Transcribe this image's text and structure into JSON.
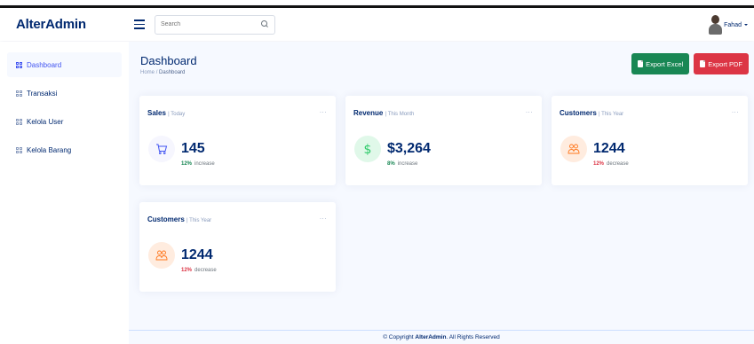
{
  "app": {
    "logo": "AlterAdmin"
  },
  "header": {
    "search_placeholder": "Search",
    "user_name": "Fahad"
  },
  "sidebar": {
    "items": [
      {
        "label": "Dashboard",
        "active": true
      },
      {
        "label": "Transaksi",
        "active": false
      },
      {
        "label": "Kelola User",
        "active": false
      },
      {
        "label": "Kelola Barang",
        "active": false
      }
    ]
  },
  "page": {
    "title": "Dashboard",
    "breadcrumb": {
      "home": "Home",
      "current": "Dashboard"
    },
    "export_excel": "Export Excel",
    "export_pdf": "Export PDF"
  },
  "cards": [
    {
      "title": "Sales",
      "period": "| Today",
      "value": "145",
      "change": "12%",
      "change_word": "increase",
      "icon": "cart-icon",
      "trend": "up"
    },
    {
      "title": "Revenue",
      "period": "| This Month",
      "value": "$3,264",
      "change": "8%",
      "change_word": "increase",
      "icon": "dollar-icon",
      "trend": "up"
    },
    {
      "title": "Customers",
      "period": "| This Year",
      "value": "1244",
      "change": "12%",
      "change_word": "decrease",
      "icon": "people-icon",
      "trend": "down"
    },
    {
      "title": "Customers",
      "period": "| This Year",
      "value": "1244",
      "change": "12%",
      "change_word": "decrease",
      "icon": "people-icon",
      "trend": "down"
    }
  ],
  "card_menu": "...",
  "footer": {
    "prefix": "© Copyright",
    "brand": "AlterAdmin",
    "suffix": ". All Rights Reserved"
  },
  "colors": {
    "primary": "#012970",
    "accent": "#4154f1",
    "success": "#198754",
    "danger": "#dc3545",
    "background": "#f6f9ff"
  }
}
